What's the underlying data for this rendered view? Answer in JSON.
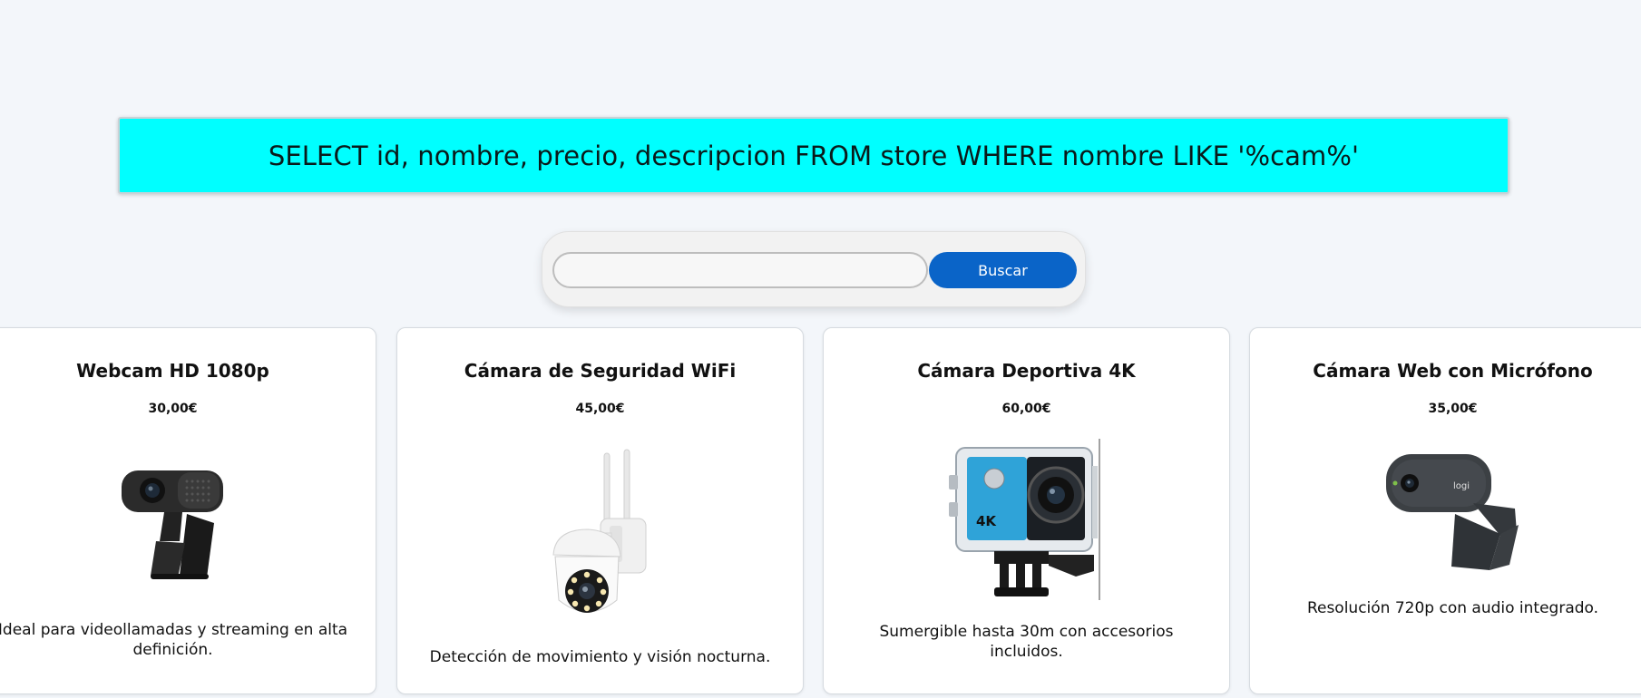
{
  "query": {
    "text": "SELECT id, nombre, precio, descripcion FROM store WHERE nombre LIKE '%cam%'"
  },
  "search": {
    "value": "",
    "placeholder": "",
    "button_label": "Buscar"
  },
  "products": [
    {
      "name": "Webcam HD 1080p",
      "price": "30,00€",
      "description": "Ideal para videollamadas y streaming en alta definición.",
      "image": "webcam-hd-image"
    },
    {
      "name": "Cámara de Seguridad WiFi",
      "price": "45,00€",
      "description": "Detección de movimiento y visión nocturna.",
      "image": "security-camera-image"
    },
    {
      "name": "Cámara Deportiva 4K",
      "price": "60,00€",
      "description": "Sumergible hasta 30m con accesorios incluidos.",
      "image": "action-camera-image"
    },
    {
      "name": "Cámara Web con Micrófono",
      "price": "35,00€",
      "description": "Resolución 720p con audio integrado.",
      "image": "webcam-mic-image"
    }
  ],
  "colors": {
    "banner": "#00ffff",
    "button": "#0a64c8",
    "background": "#f3f6fa"
  }
}
